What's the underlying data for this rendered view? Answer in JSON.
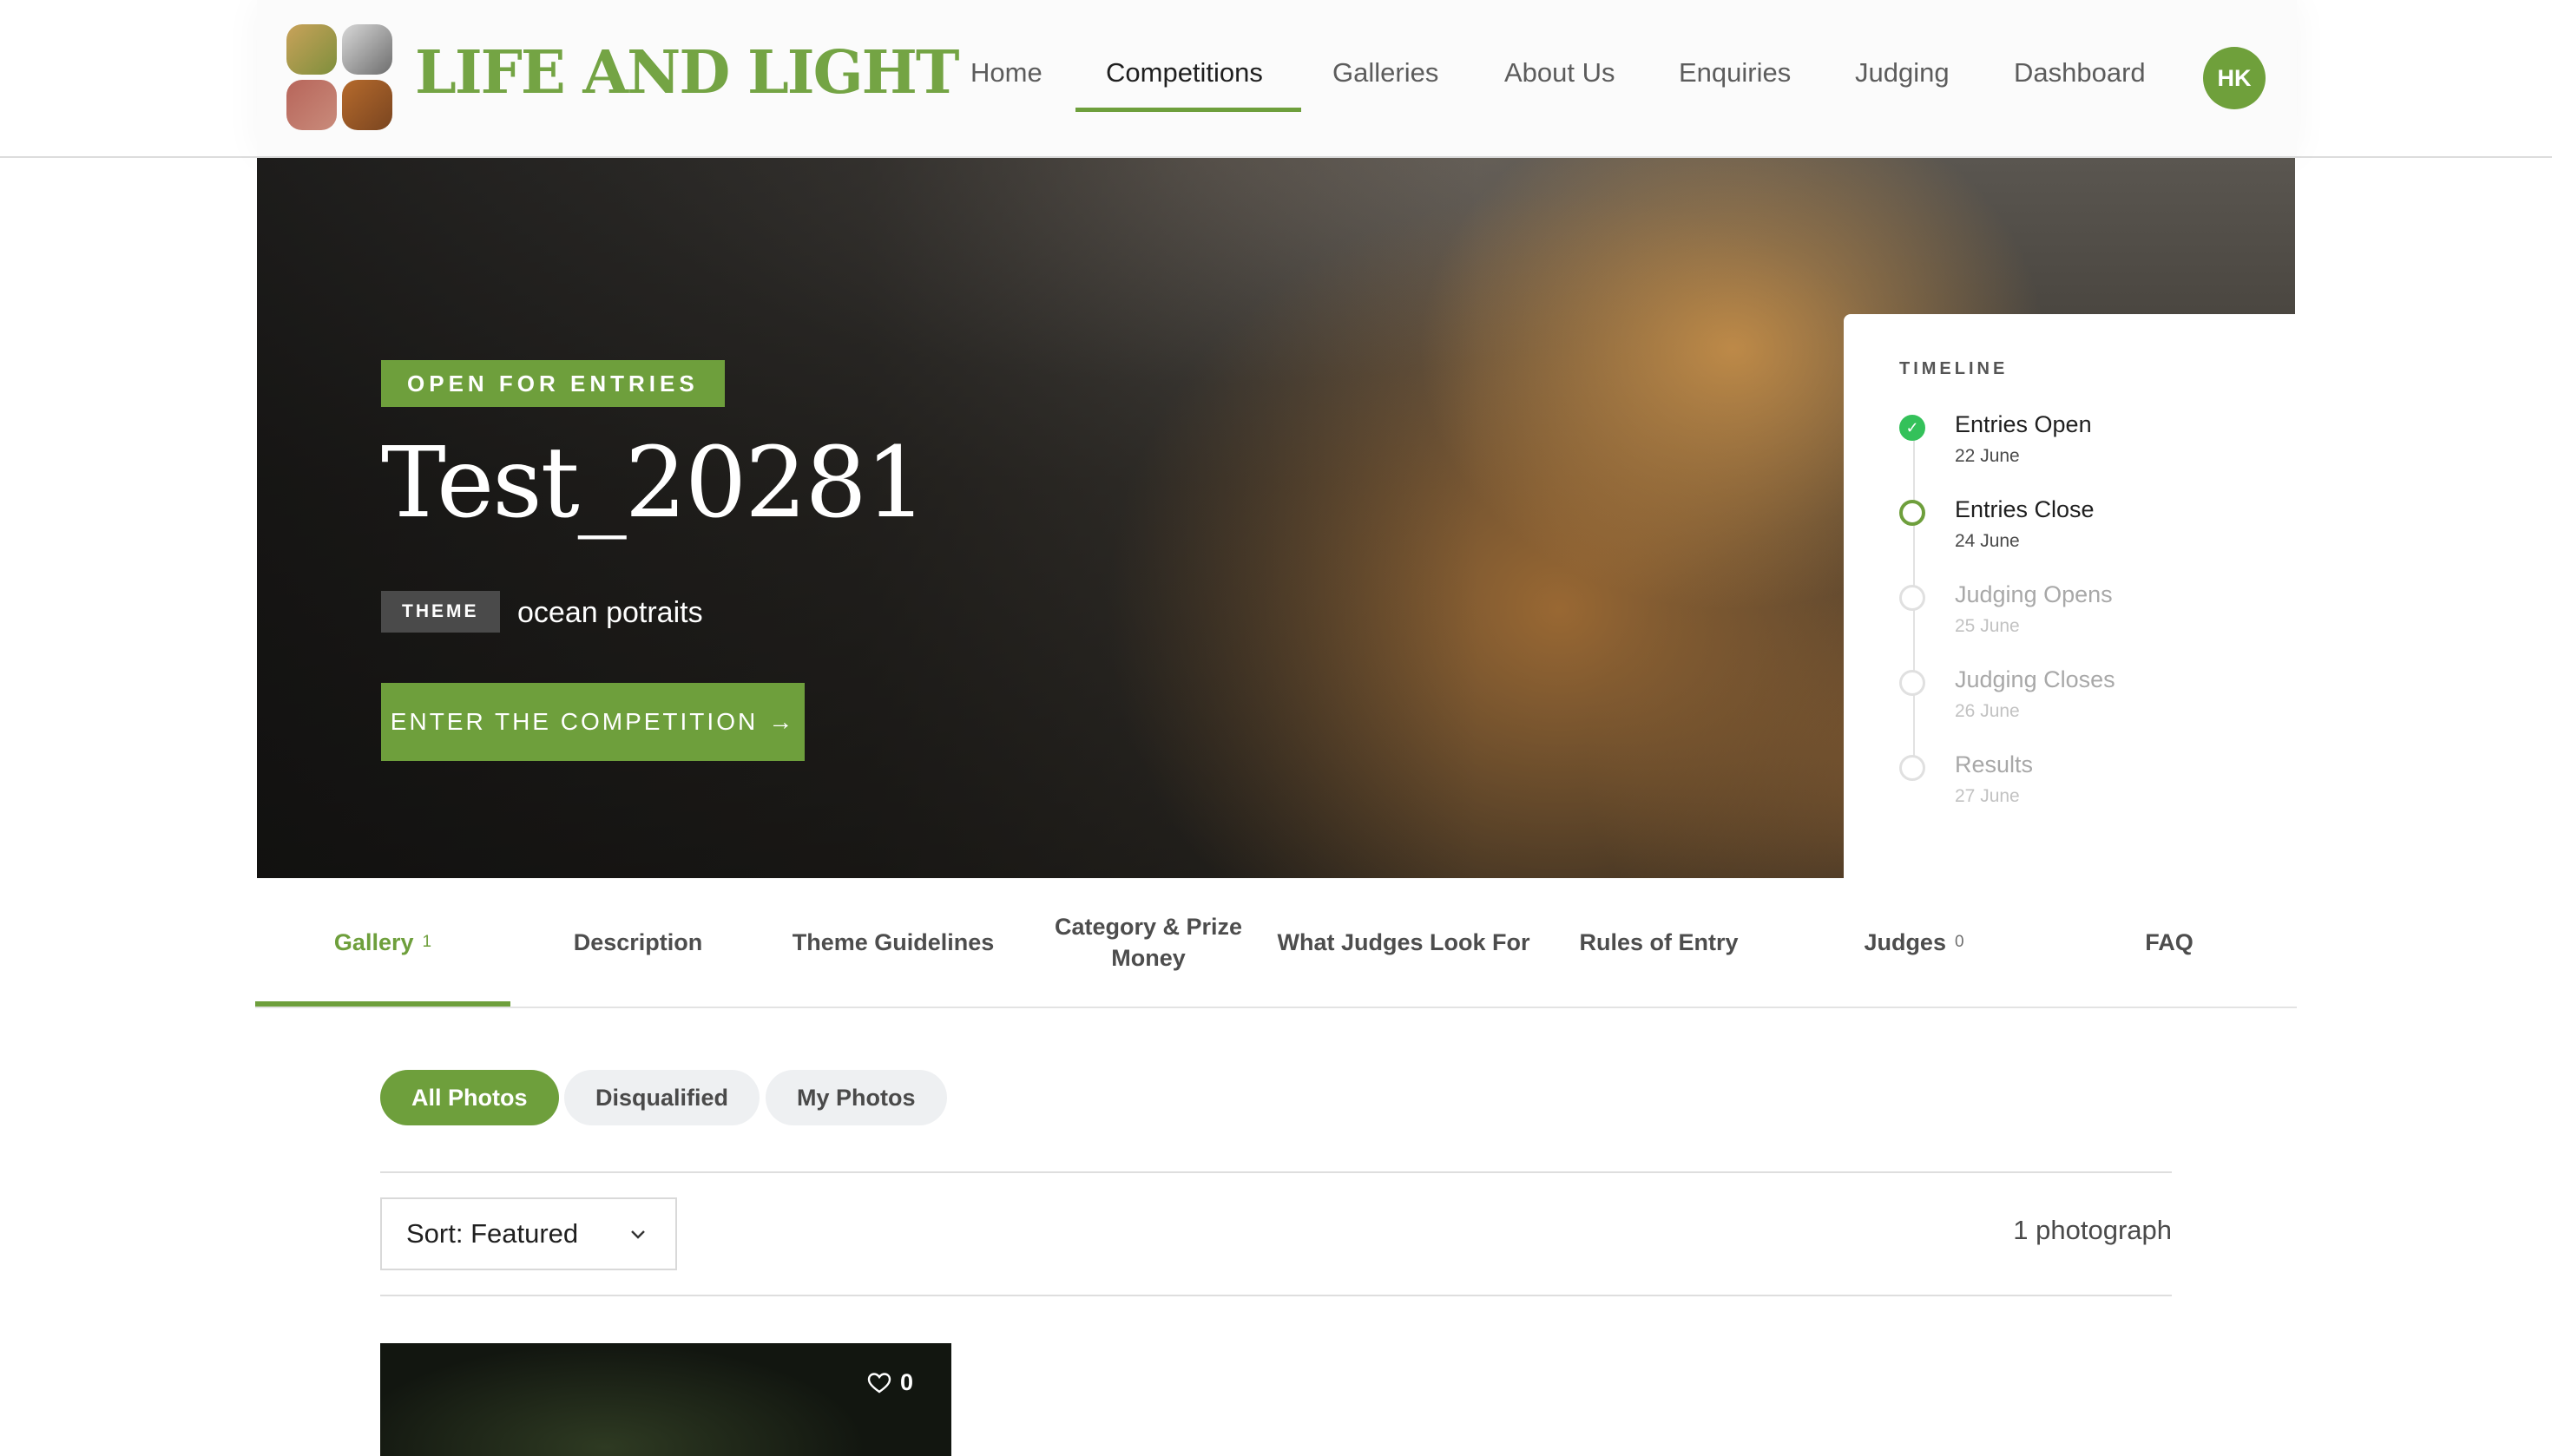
{
  "brand": {
    "name": "LIFE AND LIGHT"
  },
  "nav": {
    "items": [
      "Home",
      "Competitions",
      "Galleries",
      "About Us",
      "Enquiries",
      "Judging",
      "Dashboard"
    ],
    "active": "Competitions",
    "avatar_initials": "HK"
  },
  "hero": {
    "status_badge": "OPEN FOR ENTRIES",
    "title": "Test_20281",
    "theme_label": "THEME",
    "theme_value": "ocean potraits",
    "cta_label": "ENTER THE COMPETITION",
    "cta_arrow": "→"
  },
  "timeline": {
    "heading": "TIMELINE",
    "steps": [
      {
        "label": "Entries Open",
        "date": "22 June",
        "state": "done"
      },
      {
        "label": "Entries Close",
        "date": "24 June",
        "state": "current"
      },
      {
        "label": "Judging Opens",
        "date": "25 June",
        "state": "future"
      },
      {
        "label": "Judging Closes",
        "date": "26 June",
        "state": "future"
      },
      {
        "label": "Results",
        "date": "27 June",
        "state": "future"
      }
    ]
  },
  "tabs": [
    {
      "label": "Gallery",
      "count": "1",
      "active": true
    },
    {
      "label": "Description"
    },
    {
      "label": "Theme Guidelines"
    },
    {
      "label": "Category & Prize Money"
    },
    {
      "label": "What Judges Look For"
    },
    {
      "label": "Rules of Entry"
    },
    {
      "label": "Judges",
      "count": "0"
    },
    {
      "label": "FAQ"
    }
  ],
  "filters": {
    "all": "All Photos",
    "disqualified": "Disqualified",
    "mine": "My Photos",
    "active": "All Photos"
  },
  "sort": {
    "label": "Sort: Featured"
  },
  "results": {
    "count_text": "1 photograph"
  },
  "photos": [
    {
      "likes": "0"
    }
  ],
  "icons": {
    "logo": "photo-collage-logo",
    "check": "check-icon",
    "chevron": "chevron-down-icon",
    "heart": "heart-icon",
    "arrow": "arrow-right-icon"
  },
  "colors": {
    "accent": "#6e9f3c",
    "brand_text": "#74a444",
    "done": "#34c15a"
  }
}
